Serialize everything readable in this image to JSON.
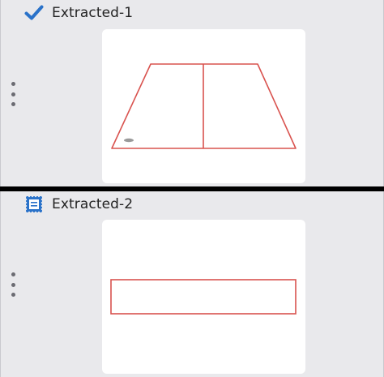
{
  "items": [
    {
      "title": "Extracted-1",
      "status_icon": "checkmark-icon",
      "menu_icon": "kebab-menu-icon",
      "shape": "trapezoid-with-divider",
      "colors": {
        "outline": "#d9534f",
        "icon": "#2a72c9"
      }
    },
    {
      "title": "Extracted-2",
      "status_icon": "document-stamp-icon",
      "menu_icon": "kebab-menu-icon",
      "shape": "rectangle",
      "colors": {
        "outline": "#d9534f",
        "icon": "#2a72c9"
      }
    }
  ]
}
